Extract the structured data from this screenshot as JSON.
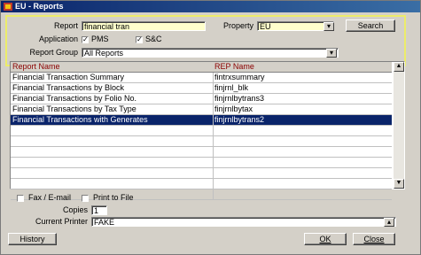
{
  "window": {
    "title": "EU - Reports"
  },
  "filter": {
    "report_label": "Report",
    "report_value": "financial tran",
    "property_label": "Property",
    "property_value": "EU",
    "search_label": "Search",
    "application_label": "Application",
    "pms_label": "PMS",
    "pms_checked": true,
    "sc_label": "S&C",
    "sc_checked": true,
    "report_group_label": "Report Group",
    "report_group_value": "All Reports"
  },
  "grid": {
    "headers": [
      "Report Name",
      "REP Name"
    ],
    "rows": [
      [
        "Financial Transaction Summary",
        "fintrxsummary"
      ],
      [
        "Financial Transactions by Block",
        "finjrnl_blk"
      ],
      [
        "Financial Transactions by Folio No.",
        "finjrnlbytrans3"
      ],
      [
        "Financial Transactions by Tax Type",
        "finjrnlbytax"
      ],
      [
        "Financial Transactions with Generates",
        "finjrnlbytrans2"
      ]
    ],
    "selected_index": 4,
    "empty_rows": 7
  },
  "options": {
    "fax_email_label": "Fax / E-mail",
    "print_to_file_label": "Print to File",
    "copies_label": "Copies",
    "copies_value": "1",
    "current_printer_label": "Current Printer",
    "current_printer_value": "FAKE"
  },
  "buttons": {
    "history": "History",
    "ok": "OK",
    "close": "Close"
  },
  "colors": {
    "title_bar": "#0a246a",
    "selection": "#0a246a",
    "header_text": "#8b0000",
    "highlight_border": "#ecec6a",
    "input_yellow": "#ffffcc"
  }
}
